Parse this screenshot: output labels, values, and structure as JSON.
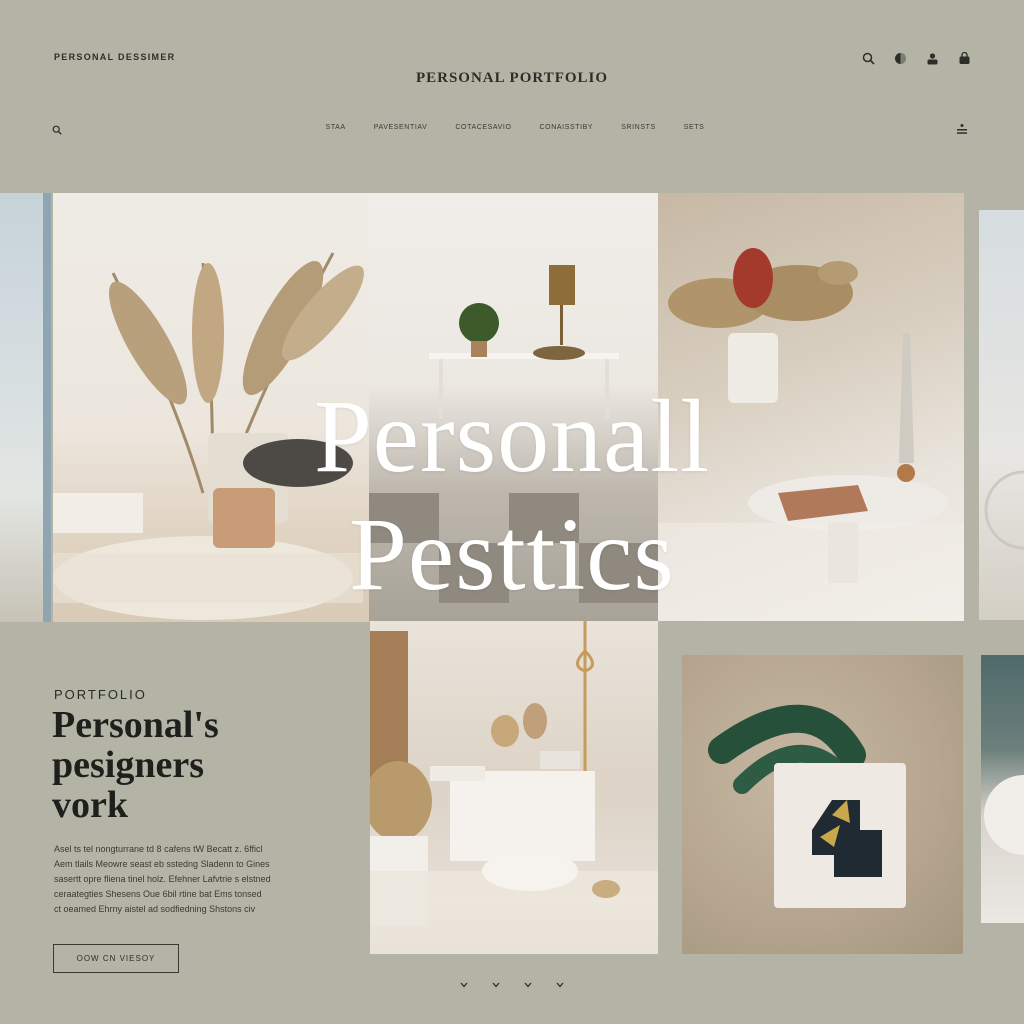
{
  "header": {
    "brand": "PERSONAL DESSIMER",
    "title": "PERSONAL PORTFOLIO",
    "icons": [
      "search-icon",
      "globe-icon",
      "user-icon",
      "cart-icon"
    ]
  },
  "nav": {
    "items": [
      "STAA",
      "PAVESENTIAV",
      "COTACESAVIO",
      "CONAISSTIBY",
      "SRINSTS",
      "SETS"
    ]
  },
  "hero": {
    "line1": "Personall",
    "line2": "Pesttics"
  },
  "intro": {
    "eyebrow": "PORTFOLIO",
    "headline_1": "Personal's",
    "headline_2": "pesigners",
    "headline_3": "vork",
    "body": [
      "Asel ts tel nongturrane td 8 cafens tW Becatt z. 6fficl",
      "Aem tlails Meowre seast eb sstedng Sladenn to Gines",
      "sasertt opre fliena tinel holz. Efehner Lafvtrie s elstned",
      "ceraategties Shesens Oue 6bil rtine bat Ems tonsed",
      "ct oeamed Ehrny aistel ad sodfiedning Shstons civ"
    ],
    "cta_label": "OOW CN VIESOY"
  },
  "pagination": {
    "arrows": [
      "chevron-down-icon",
      "chevron-down-icon",
      "chevron-down-icon",
      "chevron-down-icon"
    ]
  },
  "colors": {
    "background": "#b3b4a6",
    "text_dark": "#1f201c",
    "hero_text": "#ffffff"
  }
}
